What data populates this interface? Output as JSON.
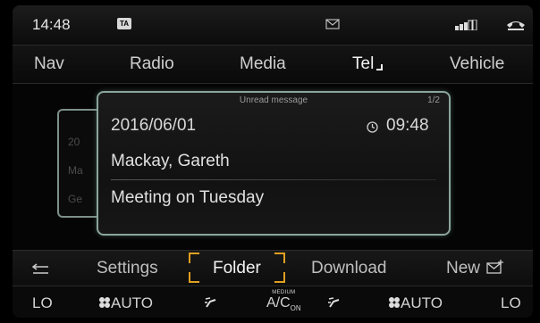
{
  "status": {
    "time": "14:48",
    "ta_badge": "TA",
    "icons": [
      "envelope-icon",
      "signal-strength-icon",
      "phone-handset-icon"
    ]
  },
  "nav": {
    "items": [
      "Nav",
      "Radio",
      "Media",
      "Tel",
      "Vehicle"
    ],
    "active": "Tel"
  },
  "message_card": {
    "header": "Unread message",
    "pager": "1/2",
    "date": "2016/06/01",
    "time": "09:48",
    "sender": "Mackay, Gareth",
    "subject": "Meeting on Tuesday"
  },
  "back_card": {
    "line1": "20",
    "line2": "Ma",
    "line3": "Ge"
  },
  "softkeys": {
    "back_icon": "back-arrow-icon",
    "settings": "Settings",
    "folder": "Folder",
    "download": "Download",
    "new": "New",
    "new_icon": "new-message-icon",
    "focused": "Folder"
  },
  "climate": {
    "left_temp": "LO",
    "left_fan": "AUTO",
    "ac_mode": "MEDIUM",
    "ac_label": "A/C",
    "ac_state": "ON",
    "right_fan": "AUTO",
    "right_temp": "LO"
  },
  "colors": {
    "focus": "#e0a020",
    "card_border": "#8aa69c",
    "background": "#000000"
  }
}
